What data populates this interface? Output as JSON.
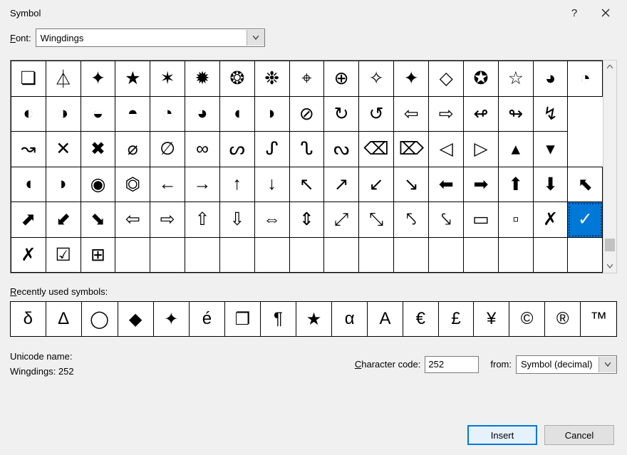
{
  "title": "Symbol",
  "font_label": "Font:",
  "font_value": "Wingdings",
  "grid_rows": [
    [
      "❏",
      "⏃",
      "✦",
      "★",
      "✶",
      "✹",
      "❂",
      "❉",
      "⌖",
      "⊕",
      "✧",
      "✦",
      "◇",
      "✪",
      "☆",
      "◕",
      "◔"
    ],
    [
      "◐",
      "◑",
      "◒",
      "◓",
      "◔",
      "◕",
      "◖",
      "◗",
      "⊘",
      "↻",
      "↺",
      "⇦",
      "⇨",
      "↫",
      "↬",
      "↯"
    ],
    [
      "↝",
      "✕",
      "✖",
      "⌀",
      "∅",
      "∞",
      "ᔕ",
      "ᔑ",
      "ᔐ",
      "ᔓ",
      "⌫",
      "⌦",
      "◁",
      "▷",
      "▴",
      "▾"
    ],
    [
      "◖",
      "◗",
      "◉",
      "⏣",
      "←",
      "→",
      "↑",
      "↓",
      "↖",
      "↗",
      "↙",
      "↘",
      "⬅",
      "➡",
      "⬆",
      "⬇",
      "⬉"
    ],
    [
      "⬈",
      "⬋",
      "⬊",
      "⇦",
      "⇨",
      "⇧",
      "⇩",
      "⇔",
      "⇕",
      "⤢",
      "⤡",
      "⤣",
      "⤥",
      "▭",
      "▫",
      "✗",
      "✓"
    ],
    [
      "✗",
      "☑",
      "⊞",
      "",
      "",
      "",
      "",
      "",
      "",
      "",
      "",
      "",
      "",
      "",
      "",
      "",
      ""
    ]
  ],
  "selected_row": 4,
  "selected_col": 16,
  "recent_label": "Recently used symbols:",
  "recent_symbols": [
    "δ",
    "Δ",
    "◯",
    "◆",
    "✦",
    "é",
    "❐",
    "¶",
    "★",
    "α",
    "A",
    "€",
    "£",
    "¥",
    "©",
    "®",
    "™"
  ],
  "unicode_name_label": "Unicode name:",
  "unicode_name_value": "Wingdings: 252",
  "char_code_label": "Character code:",
  "char_code_value": "252",
  "from_label": "from:",
  "from_value": "Symbol (decimal)",
  "insert_label": "Insert",
  "cancel_label": "Cancel"
}
